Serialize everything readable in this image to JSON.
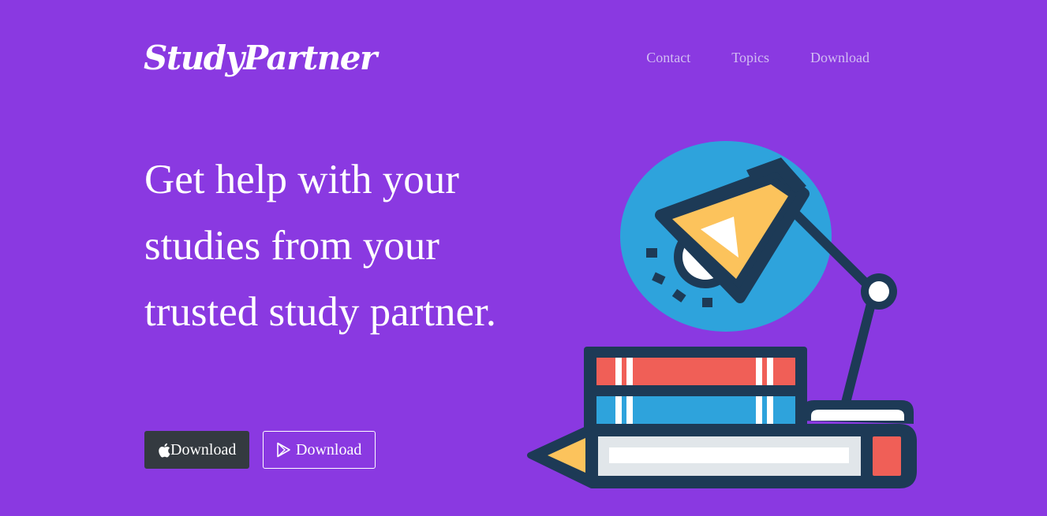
{
  "brand": {
    "name": "StudyPartner"
  },
  "nav": {
    "items": [
      {
        "label": "Contact"
      },
      {
        "label": "Topics"
      },
      {
        "label": "Download"
      }
    ]
  },
  "hero": {
    "headline": "Get help with your studies from your trusted study partner.",
    "buttons": {
      "apple": {
        "label": "Download",
        "icon": "apple-icon"
      },
      "play": {
        "label": "Download",
        "icon": "google-play-icon"
      }
    },
    "illustration": "desk-lamp-books-pencil-illustration"
  },
  "colors": {
    "background": "#8a39e1",
    "nav_link": "#d2bdf2",
    "apple_button": "#343a40",
    "illustration_navy": "#1d3a56",
    "illustration_blue": "#2ea3dc",
    "illustration_red": "#f05f57",
    "illustration_yellow": "#fcc35c"
  }
}
